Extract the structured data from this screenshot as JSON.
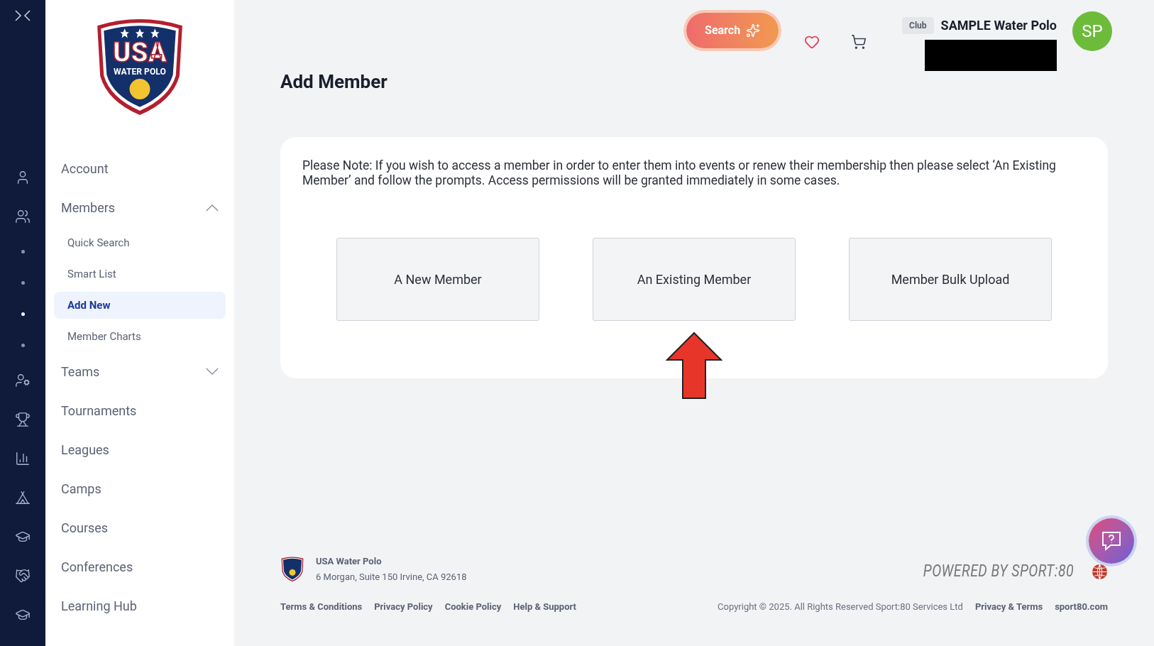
{
  "logo": {
    "line1": "USA",
    "line2": "WATER POLO"
  },
  "sidebar": {
    "items": [
      {
        "label": "Account",
        "kind": "link"
      },
      {
        "label": "Members",
        "kind": "group",
        "expanded": true,
        "children": [
          {
            "label": "Quick Search",
            "selected": false
          },
          {
            "label": "Smart List",
            "selected": false
          },
          {
            "label": "Add New",
            "selected": true
          },
          {
            "label": "Member Charts",
            "selected": false
          }
        ]
      },
      {
        "label": "Teams",
        "kind": "group",
        "expanded": false
      },
      {
        "label": "Tournaments",
        "kind": "link"
      },
      {
        "label": "Leagues",
        "kind": "link"
      },
      {
        "label": "Camps",
        "kind": "link"
      },
      {
        "label": "Courses",
        "kind": "link"
      },
      {
        "label": "Conferences",
        "kind": "link"
      },
      {
        "label": "Learning Hub",
        "kind": "link"
      }
    ]
  },
  "header": {
    "search_button": "Search",
    "account_type": "Club",
    "account_name": "SAMPLE Water Polo",
    "avatar": "SP"
  },
  "page": {
    "title": "Add Member",
    "note": "Please Note: If you wish to access a member in order to enter them into events or renew their membership then please select ‘An Existing Member’ and follow the prompts. Access permissions will be granted immediately in some cases.",
    "options": [
      {
        "label": "A New Member"
      },
      {
        "label": "An Existing Member"
      },
      {
        "label": "Member Bulk Upload"
      }
    ]
  },
  "footer": {
    "org_name": "USA Water Polo",
    "address": "6 Morgan, Suite 150 Irvine, CA 92618",
    "links": [
      "Terms & Conditions",
      "Privacy Policy",
      "Cookie Policy",
      "Help & Support"
    ],
    "powered_by": "POWERED BY SPORT:80",
    "copyright": "Copyright © 2025. All Rights Reserved Sport:80 Services Ltd",
    "right_links": [
      "Privacy & Terms",
      "sport80.com"
    ]
  }
}
